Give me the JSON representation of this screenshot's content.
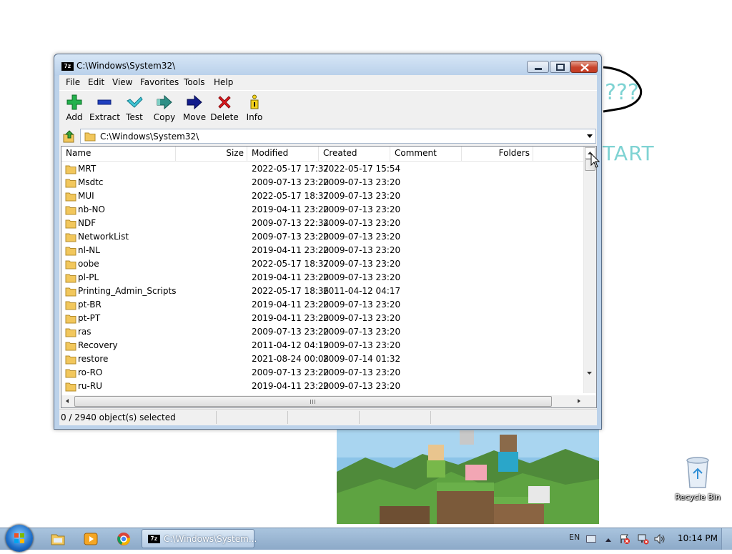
{
  "window": {
    "title": "C:\\Windows\\System32\\",
    "app_icon_text": "7z"
  },
  "menu": [
    "File",
    "Edit",
    "View",
    "Favorites",
    "Tools",
    "Help"
  ],
  "toolbar": {
    "add": "Add",
    "extract": "Extract",
    "test": "Test",
    "copy": "Copy",
    "move": "Move",
    "delete": "Delete",
    "info": "Info"
  },
  "address": {
    "path": "C:\\Windows\\System32\\"
  },
  "columns": {
    "name": "Name",
    "size": "Size",
    "modified": "Modified",
    "created": "Created",
    "comment": "Comment",
    "folders": "Folders"
  },
  "rows": [
    {
      "name": "MRT",
      "modified": "2022-05-17 17:37",
      "created": "2022-05-17 15:54"
    },
    {
      "name": "Msdtc",
      "modified": "2009-07-13 23:20",
      "created": "2009-07-13 23:20"
    },
    {
      "name": "MUI",
      "modified": "2022-05-17 18:37",
      "created": "2009-07-13 23:20"
    },
    {
      "name": "nb-NO",
      "modified": "2019-04-11 23:20",
      "created": "2009-07-13 23:20"
    },
    {
      "name": "NDF",
      "modified": "2009-07-13 22:34",
      "created": "2009-07-13 23:20"
    },
    {
      "name": "NetworkList",
      "modified": "2009-07-13 23:20",
      "created": "2009-07-13 23:20"
    },
    {
      "name": "nl-NL",
      "modified": "2019-04-11 23:20",
      "created": "2009-07-13 23:20"
    },
    {
      "name": "oobe",
      "modified": "2022-05-17 18:37",
      "created": "2009-07-13 23:20"
    },
    {
      "name": "pl-PL",
      "modified": "2019-04-11 23:20",
      "created": "2009-07-13 23:20"
    },
    {
      "name": "Printing_Admin_Scripts",
      "modified": "2022-05-17 18:36",
      "created": "2011-04-12 04:17"
    },
    {
      "name": "pt-BR",
      "modified": "2019-04-11 23:20",
      "created": "2009-07-13 23:20"
    },
    {
      "name": "pt-PT",
      "modified": "2019-04-11 23:20",
      "created": "2009-07-13 23:20"
    },
    {
      "name": "ras",
      "modified": "2009-07-13 23:20",
      "created": "2009-07-13 23:20"
    },
    {
      "name": "Recovery",
      "modified": "2011-04-12 04:19",
      "created": "2009-07-13 23:20"
    },
    {
      "name": "restore",
      "modified": "2021-08-24 00:08",
      "created": "2009-07-14 01:32"
    },
    {
      "name": "ro-RO",
      "modified": "2009-07-13 23:20",
      "created": "2009-07-13 23:20"
    },
    {
      "name": "ru-RU",
      "modified": "2019-04-11 23:20",
      "created": "2009-07-13 23:20"
    }
  ],
  "status": {
    "selection": "0 / 2940 object(s) selected"
  },
  "desktop": {
    "question_marks": "???",
    "start_text": "TART",
    "recycle_bin": "Recycle Bin"
  },
  "taskbar": {
    "active_task": "C:\\Windows\\System...",
    "language": "EN",
    "clock": "10:14 PM"
  },
  "colors": {
    "accent_text": "#7fd3d3",
    "close_button": "#c8432b",
    "folder": "#f2c75c"
  }
}
